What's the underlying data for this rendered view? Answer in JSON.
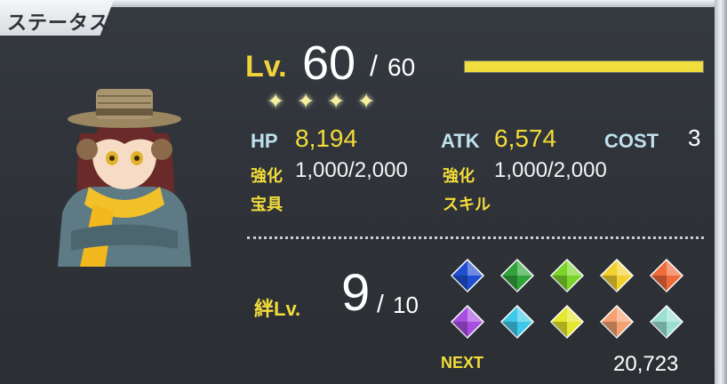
{
  "title": "ステータス",
  "level": {
    "label": "Lv.",
    "current": "60",
    "slash": "/",
    "max": "60",
    "progress": 1.0
  },
  "rarity": {
    "stars": 4,
    "star_glyph": "✦"
  },
  "stats": {
    "hp": {
      "label": "HP",
      "value": "8,194"
    },
    "atk": {
      "label": "ATK",
      "value": "6,574"
    },
    "cost": {
      "label": "COST",
      "value": "3"
    }
  },
  "enhance": {
    "hp": {
      "label": "強化",
      "value": "1,000/2,000"
    },
    "atk": {
      "label": "強化",
      "value": "1,000/2,000"
    }
  },
  "noble_phantasm_label": "宝具",
  "skill_label": "スキル",
  "bond": {
    "label": "絆Lv.",
    "current": "9",
    "slash": "/",
    "max": "10"
  },
  "bond_gems": [
    {
      "color": "#1f4fd0",
      "filled": true
    },
    {
      "color": "#2fa43a",
      "filled": true
    },
    {
      "color": "#7ad42a",
      "filled": true
    },
    {
      "color": "#f2d02e",
      "filled": true
    },
    {
      "color": "#f06a3a",
      "filled": true
    },
    {
      "color": "#a84ee0",
      "filled": true
    },
    {
      "color": "#3ec8e8",
      "filled": true
    },
    {
      "color": "#e4e82e",
      "filled": true
    },
    {
      "color": "#f4a070",
      "filled": true
    },
    {
      "color": "#9ae0d0",
      "filled": true
    }
  ],
  "next": {
    "label": "NEXT",
    "value": "20,723"
  },
  "colors": {
    "accent_yellow": "#f2dc3a",
    "label_blue": "#bfe0ee"
  },
  "avatar": {
    "icon": "servant-portrait"
  }
}
